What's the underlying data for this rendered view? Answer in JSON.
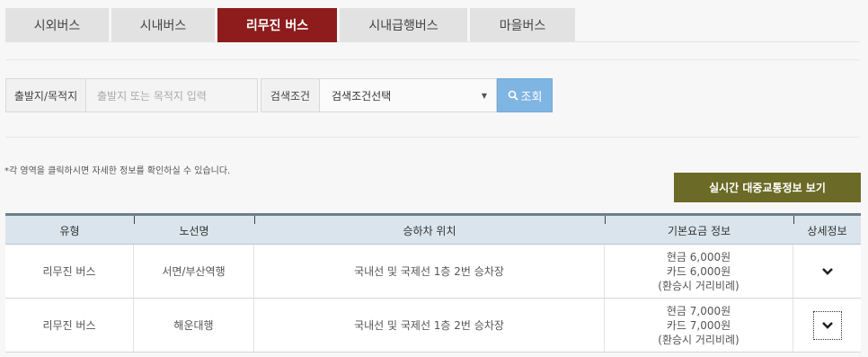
{
  "tabs": [
    {
      "label": "시외버스",
      "active": false
    },
    {
      "label": "시내버스",
      "active": false
    },
    {
      "label": "리무진 버스",
      "active": true
    },
    {
      "label": "시내급행버스",
      "active": false
    },
    {
      "label": "마을버스",
      "active": false
    }
  ],
  "search": {
    "origin_label": "출발지/목적지",
    "origin_placeholder": "출발지 또는 목적지 입력",
    "condition_label": "검색조건",
    "condition_value": "검색조건선택",
    "search_button": "조회"
  },
  "note": "*각 영역을 클릭하시면 자세한 정보를 확인하실 수 있습니다.",
  "realtime_button": "실시간 대중교통정보 보기",
  "table": {
    "headers": [
      "유형",
      "노선명",
      "승하차 위치",
      "기본요금 정보",
      "상세정보"
    ],
    "rows": [
      {
        "type": "리무진 버스",
        "route": "서면/부산역행",
        "stop": "국내선 및 국제선 1층 2번 승차장",
        "fare_cash": "현금 6,000원",
        "fare_card": "카드 6,000원",
        "fare_note": "(환승시 거리비례)"
      },
      {
        "type": "리무진 버스",
        "route": "해운대행",
        "stop": "국내선 및 국제선 1층 2번 승차장",
        "fare_cash": "현금 7,000원",
        "fare_card": "카드 7,000원",
        "fare_note": "(환승시 거리비례)"
      }
    ]
  },
  "colors": {
    "active_tab": "#8e1c1c",
    "search_button": "#7fb5e3",
    "realtime_button": "#6b6a26",
    "table_header": "#d9e4ec"
  },
  "icons": {
    "search": "search-icon",
    "detail": "chevron-down-icon",
    "select": "caret-down-icon"
  }
}
